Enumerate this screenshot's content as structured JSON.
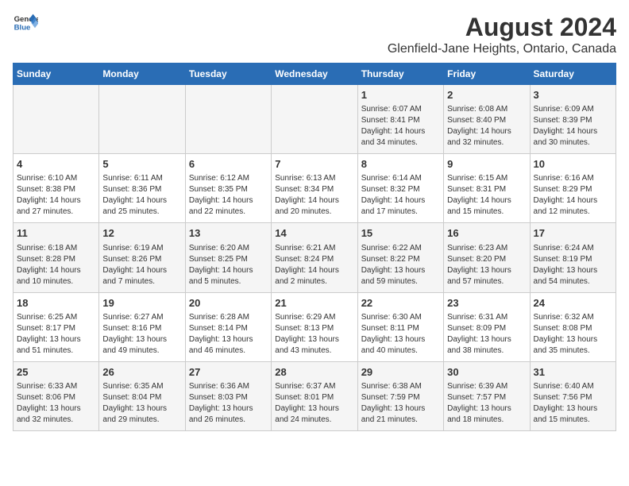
{
  "logo": {
    "line1": "General",
    "line2": "Blue"
  },
  "title": "August 2024",
  "subtitle": "Glenfield-Jane Heights, Ontario, Canada",
  "days_of_week": [
    "Sunday",
    "Monday",
    "Tuesday",
    "Wednesday",
    "Thursday",
    "Friday",
    "Saturday"
  ],
  "weeks": [
    [
      {
        "day": "",
        "info": ""
      },
      {
        "day": "",
        "info": ""
      },
      {
        "day": "",
        "info": ""
      },
      {
        "day": "",
        "info": ""
      },
      {
        "day": "1",
        "info": "Sunrise: 6:07 AM\nSunset: 8:41 PM\nDaylight: 14 hours\nand 34 minutes."
      },
      {
        "day": "2",
        "info": "Sunrise: 6:08 AM\nSunset: 8:40 PM\nDaylight: 14 hours\nand 32 minutes."
      },
      {
        "day": "3",
        "info": "Sunrise: 6:09 AM\nSunset: 8:39 PM\nDaylight: 14 hours\nand 30 minutes."
      }
    ],
    [
      {
        "day": "4",
        "info": "Sunrise: 6:10 AM\nSunset: 8:38 PM\nDaylight: 14 hours\nand 27 minutes."
      },
      {
        "day": "5",
        "info": "Sunrise: 6:11 AM\nSunset: 8:36 PM\nDaylight: 14 hours\nand 25 minutes."
      },
      {
        "day": "6",
        "info": "Sunrise: 6:12 AM\nSunset: 8:35 PM\nDaylight: 14 hours\nand 22 minutes."
      },
      {
        "day": "7",
        "info": "Sunrise: 6:13 AM\nSunset: 8:34 PM\nDaylight: 14 hours\nand 20 minutes."
      },
      {
        "day": "8",
        "info": "Sunrise: 6:14 AM\nSunset: 8:32 PM\nDaylight: 14 hours\nand 17 minutes."
      },
      {
        "day": "9",
        "info": "Sunrise: 6:15 AM\nSunset: 8:31 PM\nDaylight: 14 hours\nand 15 minutes."
      },
      {
        "day": "10",
        "info": "Sunrise: 6:16 AM\nSunset: 8:29 PM\nDaylight: 14 hours\nand 12 minutes."
      }
    ],
    [
      {
        "day": "11",
        "info": "Sunrise: 6:18 AM\nSunset: 8:28 PM\nDaylight: 14 hours\nand 10 minutes."
      },
      {
        "day": "12",
        "info": "Sunrise: 6:19 AM\nSunset: 8:26 PM\nDaylight: 14 hours\nand 7 minutes."
      },
      {
        "day": "13",
        "info": "Sunrise: 6:20 AM\nSunset: 8:25 PM\nDaylight: 14 hours\nand 5 minutes."
      },
      {
        "day": "14",
        "info": "Sunrise: 6:21 AM\nSunset: 8:24 PM\nDaylight: 14 hours\nand 2 minutes."
      },
      {
        "day": "15",
        "info": "Sunrise: 6:22 AM\nSunset: 8:22 PM\nDaylight: 13 hours\nand 59 minutes."
      },
      {
        "day": "16",
        "info": "Sunrise: 6:23 AM\nSunset: 8:20 PM\nDaylight: 13 hours\nand 57 minutes."
      },
      {
        "day": "17",
        "info": "Sunrise: 6:24 AM\nSunset: 8:19 PM\nDaylight: 13 hours\nand 54 minutes."
      }
    ],
    [
      {
        "day": "18",
        "info": "Sunrise: 6:25 AM\nSunset: 8:17 PM\nDaylight: 13 hours\nand 51 minutes."
      },
      {
        "day": "19",
        "info": "Sunrise: 6:27 AM\nSunset: 8:16 PM\nDaylight: 13 hours\nand 49 minutes."
      },
      {
        "day": "20",
        "info": "Sunrise: 6:28 AM\nSunset: 8:14 PM\nDaylight: 13 hours\nand 46 minutes."
      },
      {
        "day": "21",
        "info": "Sunrise: 6:29 AM\nSunset: 8:13 PM\nDaylight: 13 hours\nand 43 minutes."
      },
      {
        "day": "22",
        "info": "Sunrise: 6:30 AM\nSunset: 8:11 PM\nDaylight: 13 hours\nand 40 minutes."
      },
      {
        "day": "23",
        "info": "Sunrise: 6:31 AM\nSunset: 8:09 PM\nDaylight: 13 hours\nand 38 minutes."
      },
      {
        "day": "24",
        "info": "Sunrise: 6:32 AM\nSunset: 8:08 PM\nDaylight: 13 hours\nand 35 minutes."
      }
    ],
    [
      {
        "day": "25",
        "info": "Sunrise: 6:33 AM\nSunset: 8:06 PM\nDaylight: 13 hours\nand 32 minutes."
      },
      {
        "day": "26",
        "info": "Sunrise: 6:35 AM\nSunset: 8:04 PM\nDaylight: 13 hours\nand 29 minutes."
      },
      {
        "day": "27",
        "info": "Sunrise: 6:36 AM\nSunset: 8:03 PM\nDaylight: 13 hours\nand 26 minutes."
      },
      {
        "day": "28",
        "info": "Sunrise: 6:37 AM\nSunset: 8:01 PM\nDaylight: 13 hours\nand 24 minutes."
      },
      {
        "day": "29",
        "info": "Sunrise: 6:38 AM\nSunset: 7:59 PM\nDaylight: 13 hours\nand 21 minutes."
      },
      {
        "day": "30",
        "info": "Sunrise: 6:39 AM\nSunset: 7:57 PM\nDaylight: 13 hours\nand 18 minutes."
      },
      {
        "day": "31",
        "info": "Sunrise: 6:40 AM\nSunset: 7:56 PM\nDaylight: 13 hours\nand 15 minutes."
      }
    ]
  ]
}
